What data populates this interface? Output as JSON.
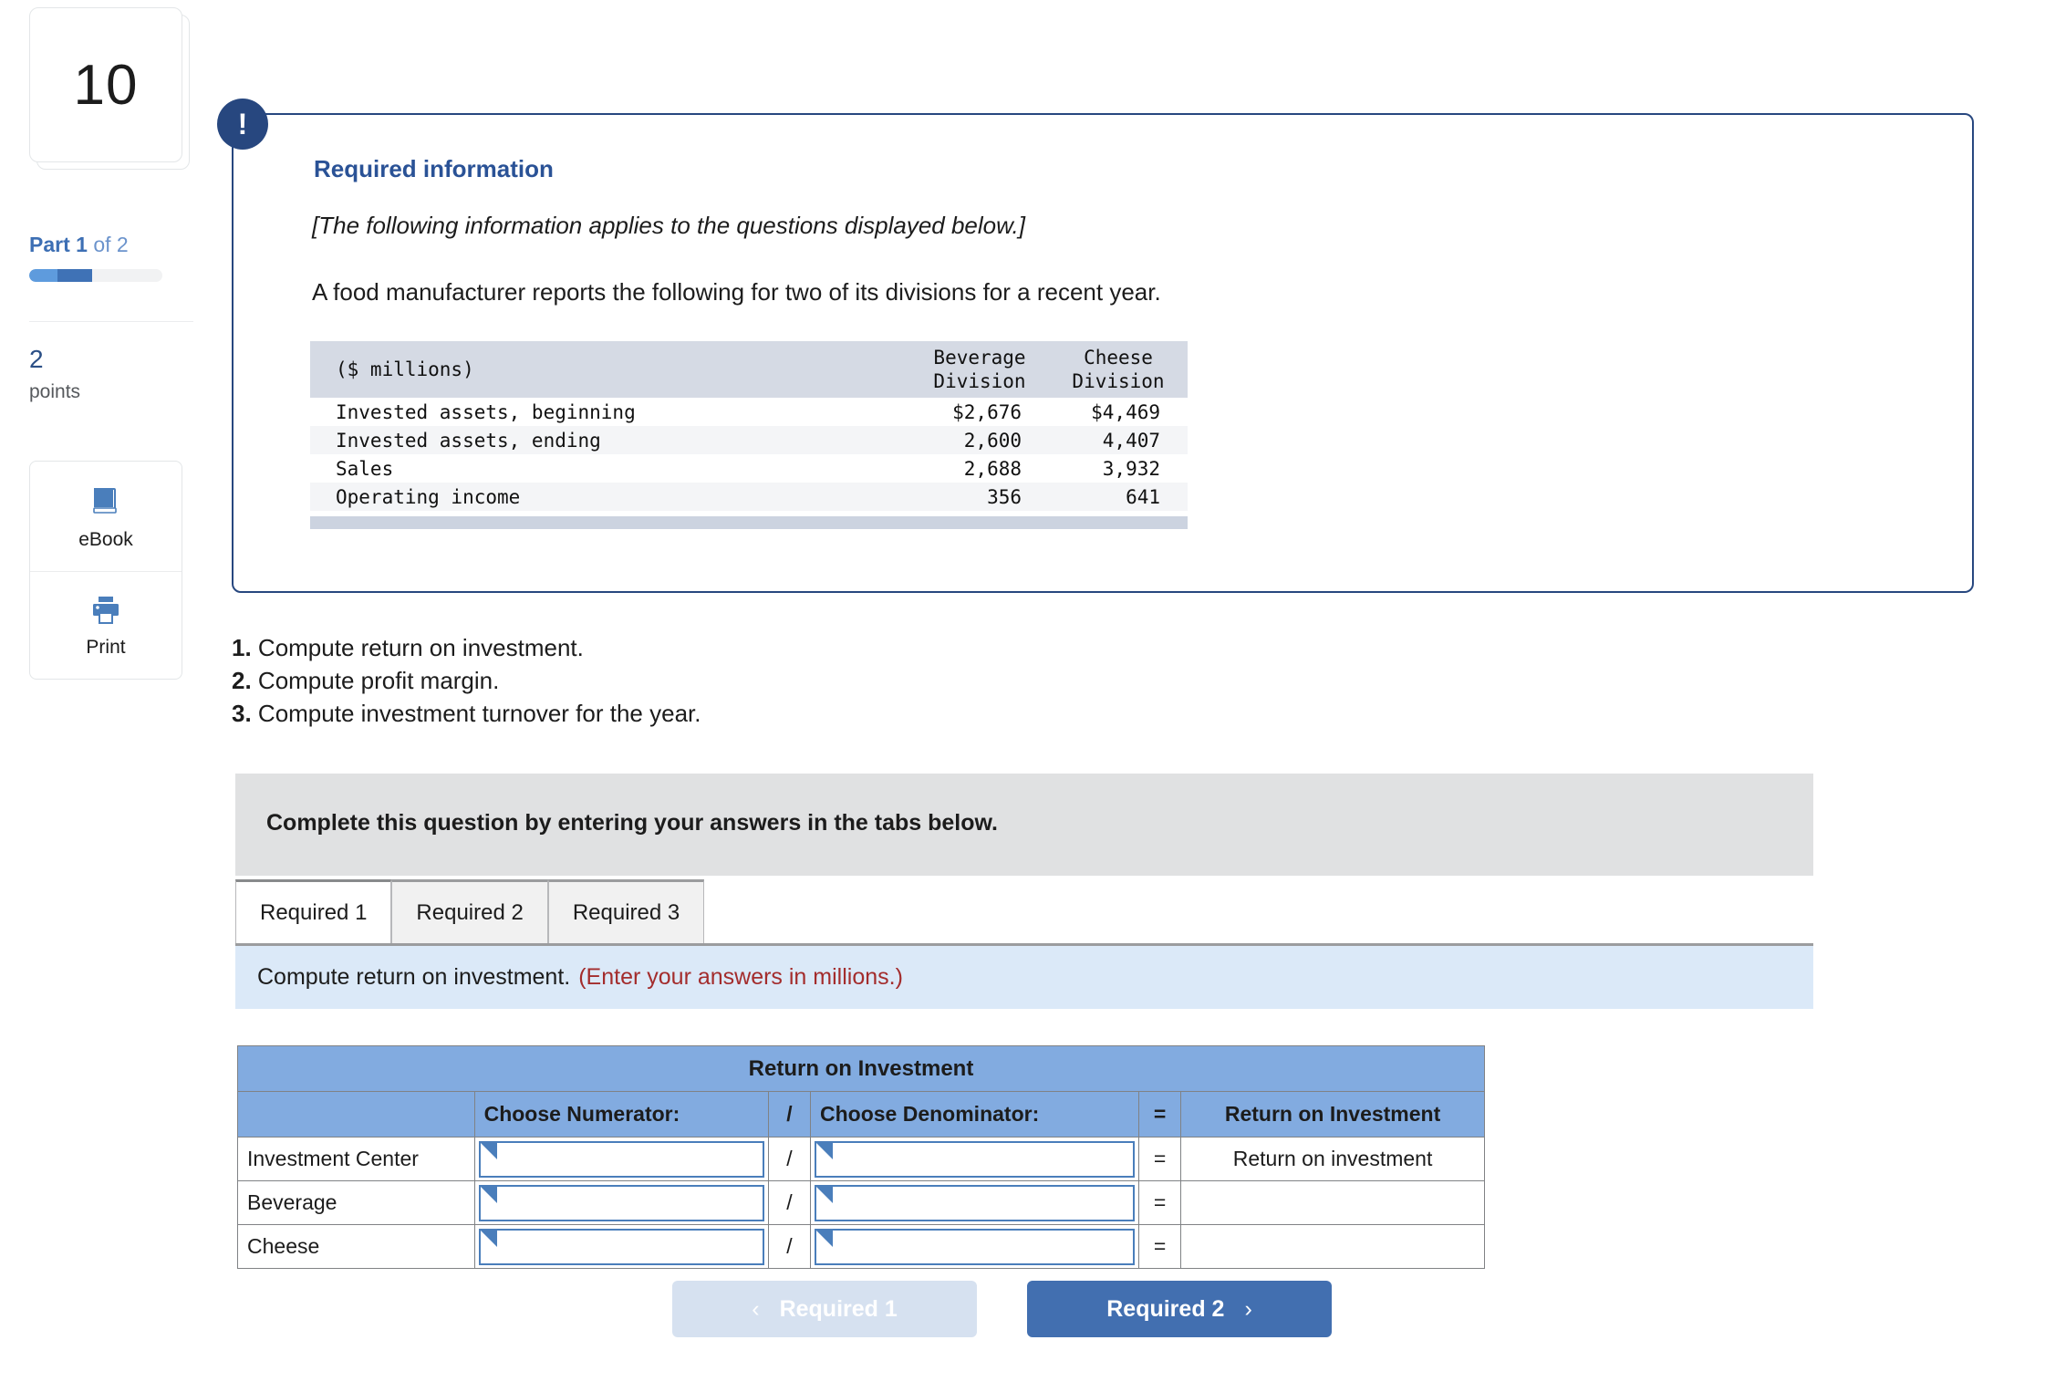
{
  "sidebar": {
    "question_number": "10",
    "part_label_prefix": "Part 1",
    "part_label_suffix": " of 2",
    "progress_percent": 47,
    "points_value": "2",
    "points_label": "points",
    "tools": [
      {
        "icon": "ebook-icon",
        "label": "eBook"
      },
      {
        "icon": "printer-icon",
        "label": "Print"
      }
    ]
  },
  "info_box": {
    "icon": "exclamation-icon",
    "icon_glyph": "!",
    "title": "Required information",
    "italic_note": "[The following information applies to the questions displayed below.]",
    "intro": "A food manufacturer reports the following for two of its divisions for a recent year."
  },
  "data_table": {
    "col_label": "($ millions)",
    "col_beverage_line1": "Beverage",
    "col_beverage_line2": "Division",
    "col_cheese_line1": "Cheese",
    "col_cheese_line2": "Division",
    "rows": [
      {
        "label": "Invested assets, beginning",
        "beverage": "$2,676",
        "cheese": "$4,469"
      },
      {
        "label": "Invested assets, ending",
        "beverage": "2,600",
        "cheese": "4,407"
      },
      {
        "label": "Sales",
        "beverage": "2,688",
        "cheese": "3,932"
      },
      {
        "label": "Operating income",
        "beverage": "356",
        "cheese": "641"
      }
    ]
  },
  "questions": [
    {
      "num": "1.",
      "text": " Compute return on investment."
    },
    {
      "num": "2.",
      "text": " Compute profit margin."
    },
    {
      "num": "3.",
      "text": " Compute investment turnover for the year."
    }
  ],
  "instruction_bar": {
    "text": "Complete this question by entering your answers in the tabs below."
  },
  "tabs": [
    {
      "label": "Required 1",
      "active": true
    },
    {
      "label": "Required 2",
      "active": false
    },
    {
      "label": "Required 3",
      "active": false
    }
  ],
  "tab_prompt": {
    "text": "Compute return on investment.",
    "hint": "(Enter your answers in millions.)"
  },
  "answer_table": {
    "title": "Return on Investment",
    "headers": {
      "rowlabel": "",
      "numerator": "Choose Numerator:",
      "slash": "/",
      "denominator": "Choose Denominator:",
      "equals": "=",
      "result": "Return on Investment"
    },
    "rows": [
      {
        "label": "Investment Center",
        "numerator": "",
        "slash": "/",
        "denominator": "",
        "equals": "=",
        "result": "Return on investment"
      },
      {
        "label": "Beverage",
        "numerator": "",
        "slash": "/",
        "denominator": "",
        "equals": "=",
        "result": ""
      },
      {
        "label": "Cheese",
        "numerator": "",
        "slash": "/",
        "denominator": "",
        "equals": "=",
        "result": ""
      }
    ]
  },
  "footer": {
    "prev_label": "Required 1",
    "prev_chevron": "‹",
    "next_label": "Required 2",
    "next_chevron": "›"
  },
  "colors": {
    "brand_navy": "#27477f",
    "accent_blue": "#426fb0",
    "table_header_blue": "#82abe0",
    "prompt_bar_blue": "#dbe9f8",
    "instruction_grey": "#e0e1e2",
    "hint_red": "#a32c2c"
  }
}
